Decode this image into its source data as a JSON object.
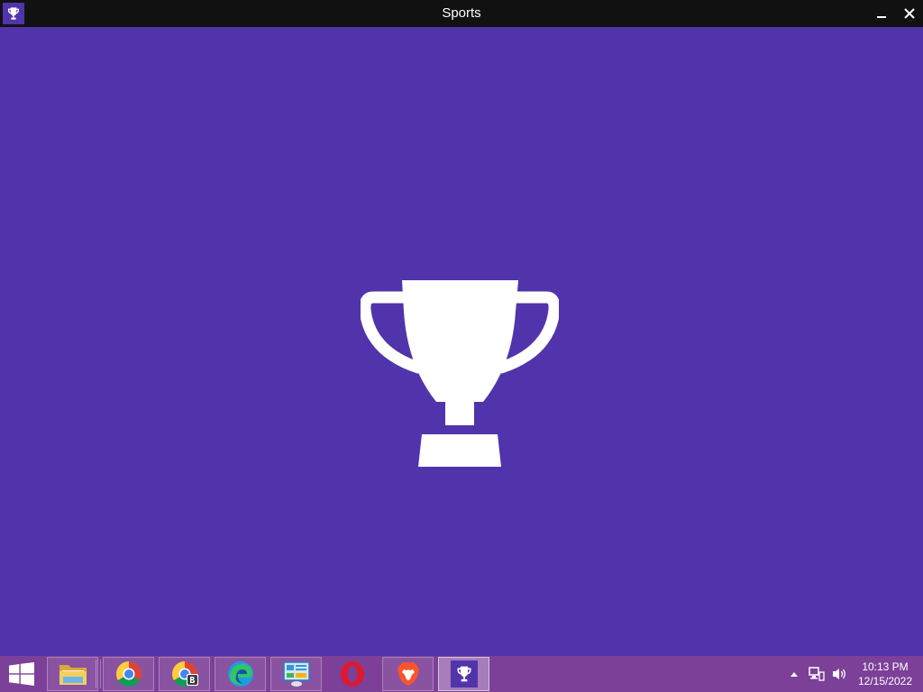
{
  "window": {
    "title": "Sports",
    "icon": "trophy-icon",
    "background": "#5133ab"
  },
  "taskbar": {
    "background": "#7c4098",
    "start_icon": "windows-logo-icon",
    "apps": [
      {
        "name": "File Explorer",
        "icon": "folder-icon"
      },
      {
        "name": "Google Chrome",
        "icon": "chrome-icon"
      },
      {
        "name": "Chrome Beta",
        "icon": "chrome-beta-icon"
      },
      {
        "name": "Microsoft Edge",
        "icon": "edge-icon"
      },
      {
        "name": "Control Panel",
        "icon": "control-panel-icon"
      },
      {
        "name": "Opera",
        "icon": "opera-icon"
      },
      {
        "name": "Brave",
        "icon": "brave-icon"
      },
      {
        "name": "Sports",
        "icon": "trophy-icon",
        "active": true
      }
    ],
    "tray": {
      "time": "10:13 PM",
      "date": "12/15/2022"
    }
  }
}
